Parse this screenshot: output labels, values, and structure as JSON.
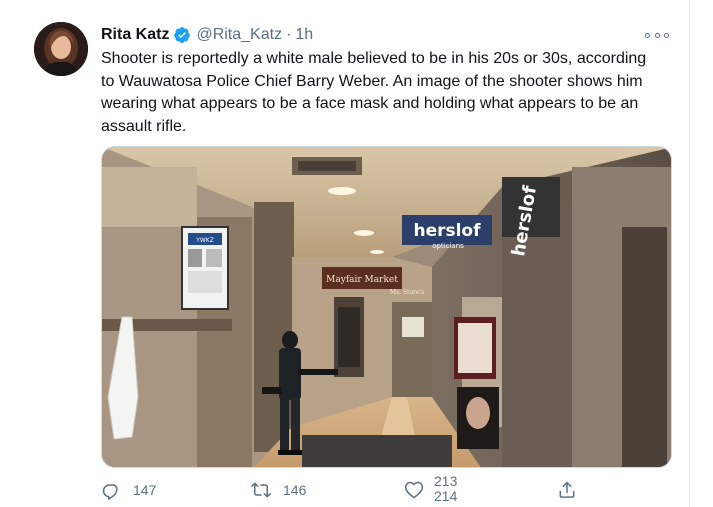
{
  "tweet": {
    "author_name": "Rita Katz",
    "verified_icon": "verified-badge-icon",
    "handle": "@Rita_Katz",
    "separator": "·",
    "time": "1h",
    "more_icon": "more-options-icon",
    "text": "Shooter is reportedly a white male believed to be in his 20s or 30s, according\nto Wauwatosa Police Chief Barry Weber. An image of the shooter shows him\nwearing what appears to be a face mask and holding what appears to be an\nassault rifle.",
    "media": {
      "signs": {
        "herslof_big": "herslof",
        "herslof_small": "herslof",
        "opticians": "opticians",
        "mayfair": "Mayfair Market",
        "ms_store": "Ms. Store's",
        "ysmi": "YWKZ"
      }
    },
    "actions": {
      "reply_icon": "reply-icon",
      "reply_count": "147",
      "retweet_icon": "retweet-icon",
      "retweet_count": "146",
      "like_icon": "heart-icon",
      "like_count_old": "213",
      "like_count_new": "214",
      "share_icon": "share-icon"
    },
    "colors": {
      "verified": "#1da1f2",
      "secondary_text": "#5b7083",
      "border": "#cfd9de"
    }
  }
}
